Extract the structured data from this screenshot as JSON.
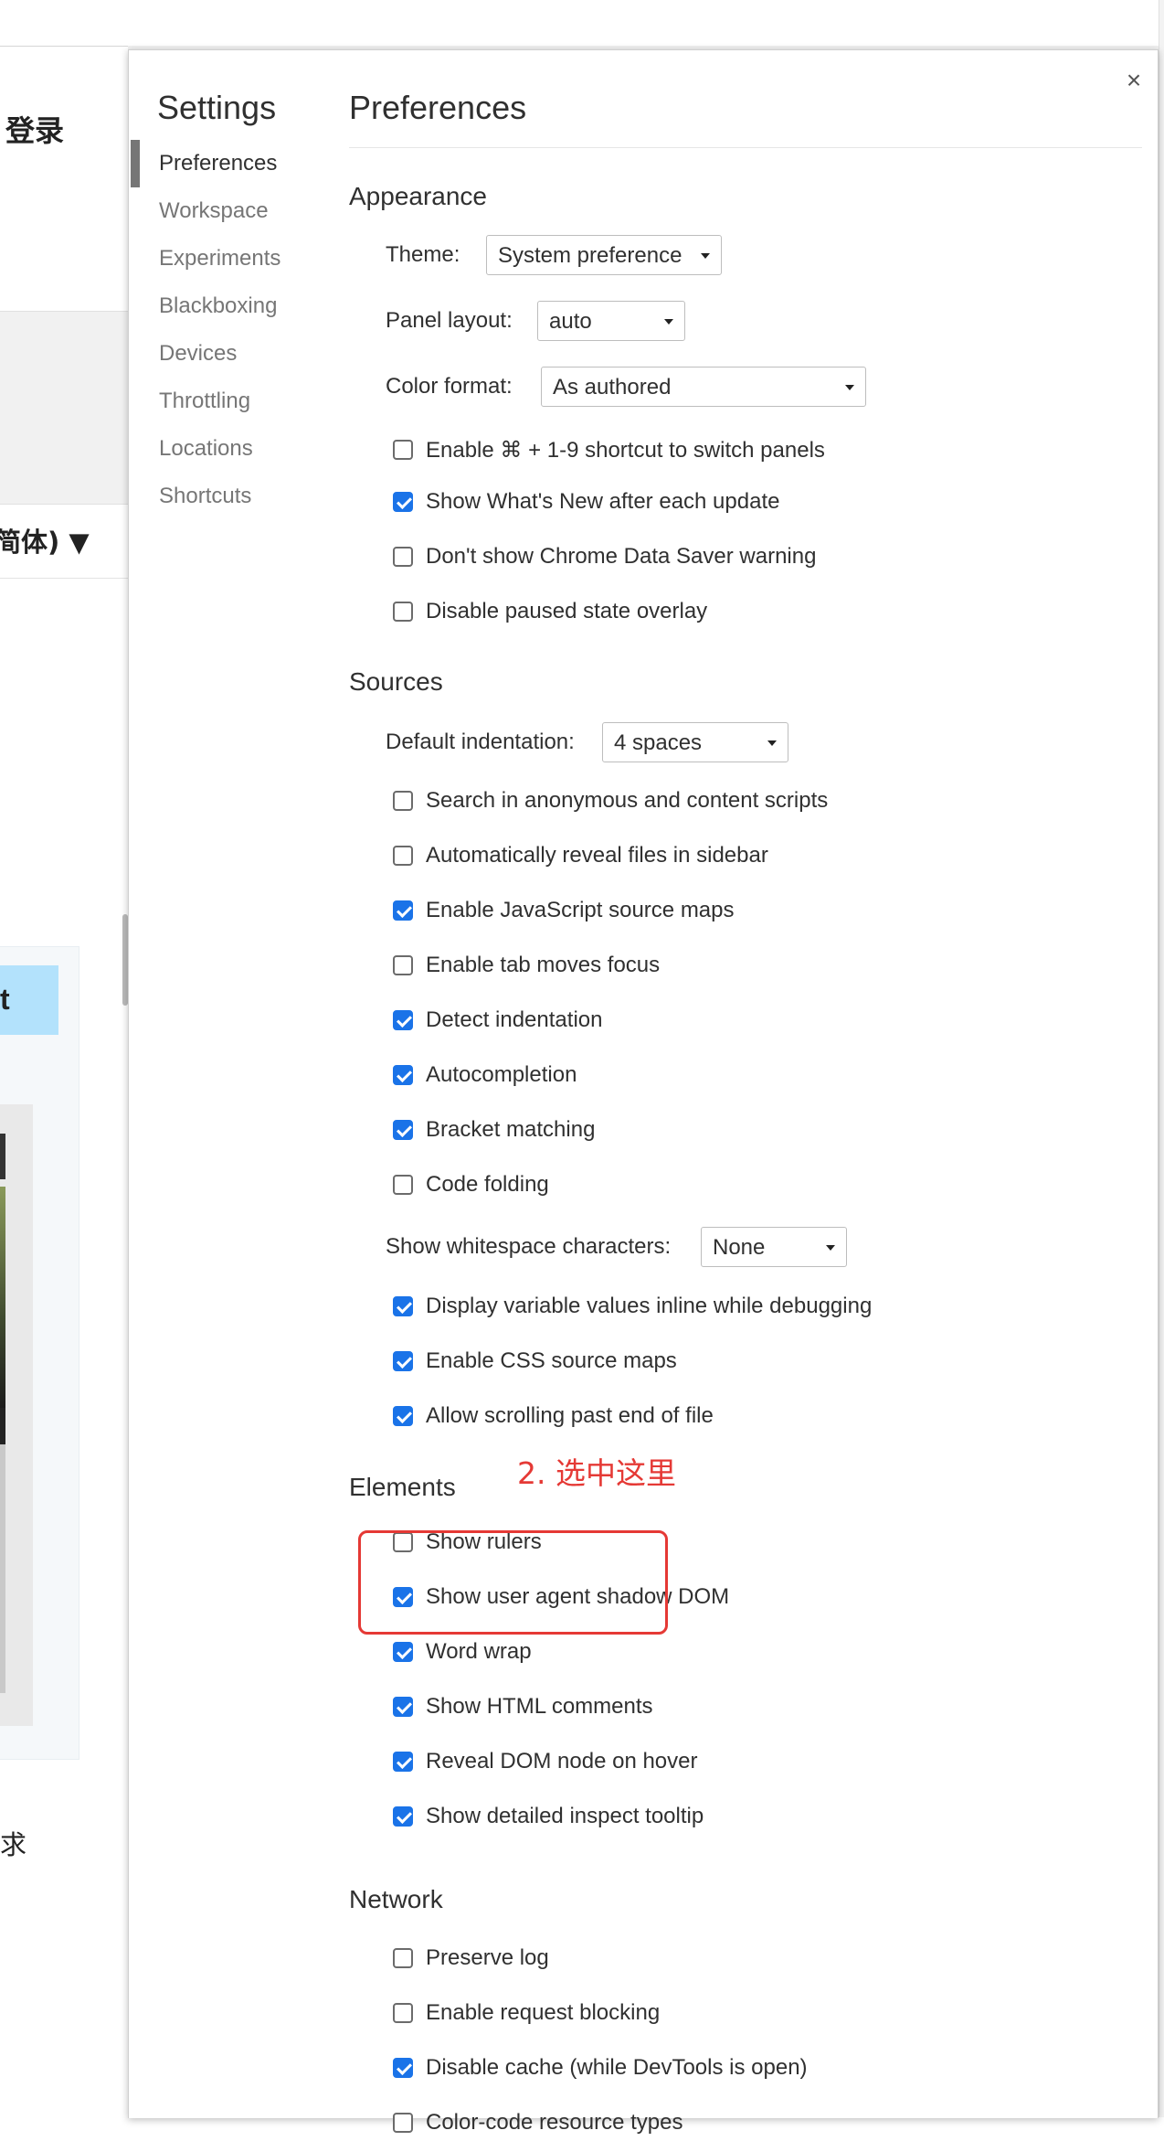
{
  "background_page": {
    "login_text": "登录",
    "language_text": "简体) ▼",
    "card_text": "t",
    "fragment_text": "求"
  },
  "settings": {
    "title": "Settings",
    "close_icon": "×",
    "nav": [
      {
        "label": "Preferences",
        "active": true
      },
      {
        "label": "Workspace"
      },
      {
        "label": "Experiments"
      },
      {
        "label": "Blackboxing"
      },
      {
        "label": "Devices"
      },
      {
        "label": "Throttling"
      },
      {
        "label": "Locations"
      },
      {
        "label": "Shortcuts"
      }
    ],
    "panel_title": "Preferences",
    "appearance": {
      "heading": "Appearance",
      "theme_label": "Theme:",
      "theme_value": "System preference",
      "panel_layout_label": "Panel layout:",
      "panel_layout_value": "auto",
      "color_format_label": "Color format:",
      "color_format_value": "As authored",
      "checks": [
        {
          "label": "Enable ⌘ + 1-9 shortcut to switch panels",
          "checked": false
        },
        {
          "label": "Show What's New after each update",
          "checked": true
        },
        {
          "label": "Don't show Chrome Data Saver warning",
          "checked": false
        },
        {
          "label": "Disable paused state overlay",
          "checked": false
        }
      ]
    },
    "sources": {
      "heading": "Sources",
      "indentation_label": "Default indentation:",
      "indentation_value": "4 spaces",
      "checks": [
        {
          "label": "Search in anonymous and content scripts",
          "checked": false
        },
        {
          "label": "Automatically reveal files in sidebar",
          "checked": false
        },
        {
          "label": "Enable JavaScript source maps",
          "checked": true
        },
        {
          "label": "Enable tab moves focus",
          "checked": false
        },
        {
          "label": "Detect indentation",
          "checked": true
        },
        {
          "label": "Autocompletion",
          "checked": true
        },
        {
          "label": "Bracket matching",
          "checked": true
        },
        {
          "label": "Code folding",
          "checked": false
        }
      ],
      "whitespace_label": "Show whitespace characters:",
      "whitespace_value": "None",
      "checks2": [
        {
          "label": "Display variable values inline while debugging",
          "checked": true
        },
        {
          "label": "Enable CSS source maps",
          "checked": true
        },
        {
          "label": "Allow scrolling past end of file",
          "checked": true
        }
      ]
    },
    "elements": {
      "heading": "Elements",
      "checks": [
        {
          "label": "Show rulers",
          "checked": false
        },
        {
          "label": "Show user agent shadow DOM",
          "checked": true
        },
        {
          "label": "Word wrap",
          "checked": true
        },
        {
          "label": "Show HTML comments",
          "checked": true
        },
        {
          "label": "Reveal DOM node on hover",
          "checked": true
        },
        {
          "label": "Show detailed inspect tooltip",
          "checked": true
        }
      ]
    },
    "network": {
      "heading": "Network",
      "checks": [
        {
          "label": "Preserve log",
          "checked": false
        },
        {
          "label": "Enable request blocking",
          "checked": false
        },
        {
          "label": "Disable cache (while DevTools is open)",
          "checked": true
        },
        {
          "label": "Color-code resource types",
          "checked": false
        }
      ]
    }
  },
  "annotation": {
    "text": "2. 选中这里",
    "color": "#e53935"
  }
}
